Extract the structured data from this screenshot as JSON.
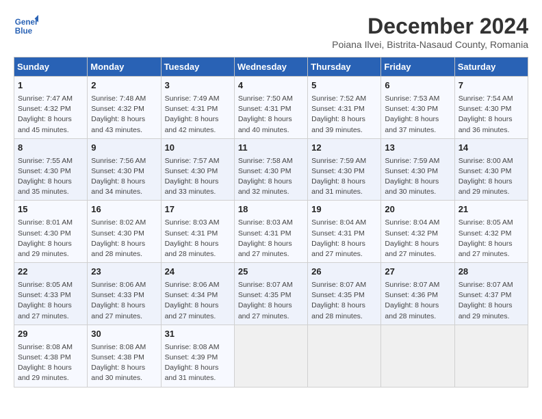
{
  "logo": {
    "line1": "General",
    "line2": "Blue"
  },
  "title": "December 2024",
  "location": "Poiana Ilvei, Bistrita-Nasaud County, Romania",
  "days_of_week": [
    "Sunday",
    "Monday",
    "Tuesday",
    "Wednesday",
    "Thursday",
    "Friday",
    "Saturday"
  ],
  "weeks": [
    [
      {
        "day": 1,
        "sunrise": "7:47 AM",
        "sunset": "4:32 PM",
        "daylight": "8 hours and 45 minutes."
      },
      {
        "day": 2,
        "sunrise": "7:48 AM",
        "sunset": "4:32 PM",
        "daylight": "8 hours and 43 minutes."
      },
      {
        "day": 3,
        "sunrise": "7:49 AM",
        "sunset": "4:31 PM",
        "daylight": "8 hours and 42 minutes."
      },
      {
        "day": 4,
        "sunrise": "7:50 AM",
        "sunset": "4:31 PM",
        "daylight": "8 hours and 40 minutes."
      },
      {
        "day": 5,
        "sunrise": "7:52 AM",
        "sunset": "4:31 PM",
        "daylight": "8 hours and 39 minutes."
      },
      {
        "day": 6,
        "sunrise": "7:53 AM",
        "sunset": "4:30 PM",
        "daylight": "8 hours and 37 minutes."
      },
      {
        "day": 7,
        "sunrise": "7:54 AM",
        "sunset": "4:30 PM",
        "daylight": "8 hours and 36 minutes."
      }
    ],
    [
      {
        "day": 8,
        "sunrise": "7:55 AM",
        "sunset": "4:30 PM",
        "daylight": "8 hours and 35 minutes."
      },
      {
        "day": 9,
        "sunrise": "7:56 AM",
        "sunset": "4:30 PM",
        "daylight": "8 hours and 34 minutes."
      },
      {
        "day": 10,
        "sunrise": "7:57 AM",
        "sunset": "4:30 PM",
        "daylight": "8 hours and 33 minutes."
      },
      {
        "day": 11,
        "sunrise": "7:58 AM",
        "sunset": "4:30 PM",
        "daylight": "8 hours and 32 minutes."
      },
      {
        "day": 12,
        "sunrise": "7:59 AM",
        "sunset": "4:30 PM",
        "daylight": "8 hours and 31 minutes."
      },
      {
        "day": 13,
        "sunrise": "7:59 AM",
        "sunset": "4:30 PM",
        "daylight": "8 hours and 30 minutes."
      },
      {
        "day": 14,
        "sunrise": "8:00 AM",
        "sunset": "4:30 PM",
        "daylight": "8 hours and 29 minutes."
      }
    ],
    [
      {
        "day": 15,
        "sunrise": "8:01 AM",
        "sunset": "4:30 PM",
        "daylight": "8 hours and 29 minutes."
      },
      {
        "day": 16,
        "sunrise": "8:02 AM",
        "sunset": "4:30 PM",
        "daylight": "8 hours and 28 minutes."
      },
      {
        "day": 17,
        "sunrise": "8:03 AM",
        "sunset": "4:31 PM",
        "daylight": "8 hours and 28 minutes."
      },
      {
        "day": 18,
        "sunrise": "8:03 AM",
        "sunset": "4:31 PM",
        "daylight": "8 hours and 27 minutes."
      },
      {
        "day": 19,
        "sunrise": "8:04 AM",
        "sunset": "4:31 PM",
        "daylight": "8 hours and 27 minutes."
      },
      {
        "day": 20,
        "sunrise": "8:04 AM",
        "sunset": "4:32 PM",
        "daylight": "8 hours and 27 minutes."
      },
      {
        "day": 21,
        "sunrise": "8:05 AM",
        "sunset": "4:32 PM",
        "daylight": "8 hours and 27 minutes."
      }
    ],
    [
      {
        "day": 22,
        "sunrise": "8:05 AM",
        "sunset": "4:33 PM",
        "daylight": "8 hours and 27 minutes."
      },
      {
        "day": 23,
        "sunrise": "8:06 AM",
        "sunset": "4:33 PM",
        "daylight": "8 hours and 27 minutes."
      },
      {
        "day": 24,
        "sunrise": "8:06 AM",
        "sunset": "4:34 PM",
        "daylight": "8 hours and 27 minutes."
      },
      {
        "day": 25,
        "sunrise": "8:07 AM",
        "sunset": "4:35 PM",
        "daylight": "8 hours and 27 minutes."
      },
      {
        "day": 26,
        "sunrise": "8:07 AM",
        "sunset": "4:35 PM",
        "daylight": "8 hours and 28 minutes."
      },
      {
        "day": 27,
        "sunrise": "8:07 AM",
        "sunset": "4:36 PM",
        "daylight": "8 hours and 28 minutes."
      },
      {
        "day": 28,
        "sunrise": "8:07 AM",
        "sunset": "4:37 PM",
        "daylight": "8 hours and 29 minutes."
      }
    ],
    [
      {
        "day": 29,
        "sunrise": "8:08 AM",
        "sunset": "4:38 PM",
        "daylight": "8 hours and 29 minutes."
      },
      {
        "day": 30,
        "sunrise": "8:08 AM",
        "sunset": "4:38 PM",
        "daylight": "8 hours and 30 minutes."
      },
      {
        "day": 31,
        "sunrise": "8:08 AM",
        "sunset": "4:39 PM",
        "daylight": "8 hours and 31 minutes."
      },
      null,
      null,
      null,
      null
    ]
  ]
}
